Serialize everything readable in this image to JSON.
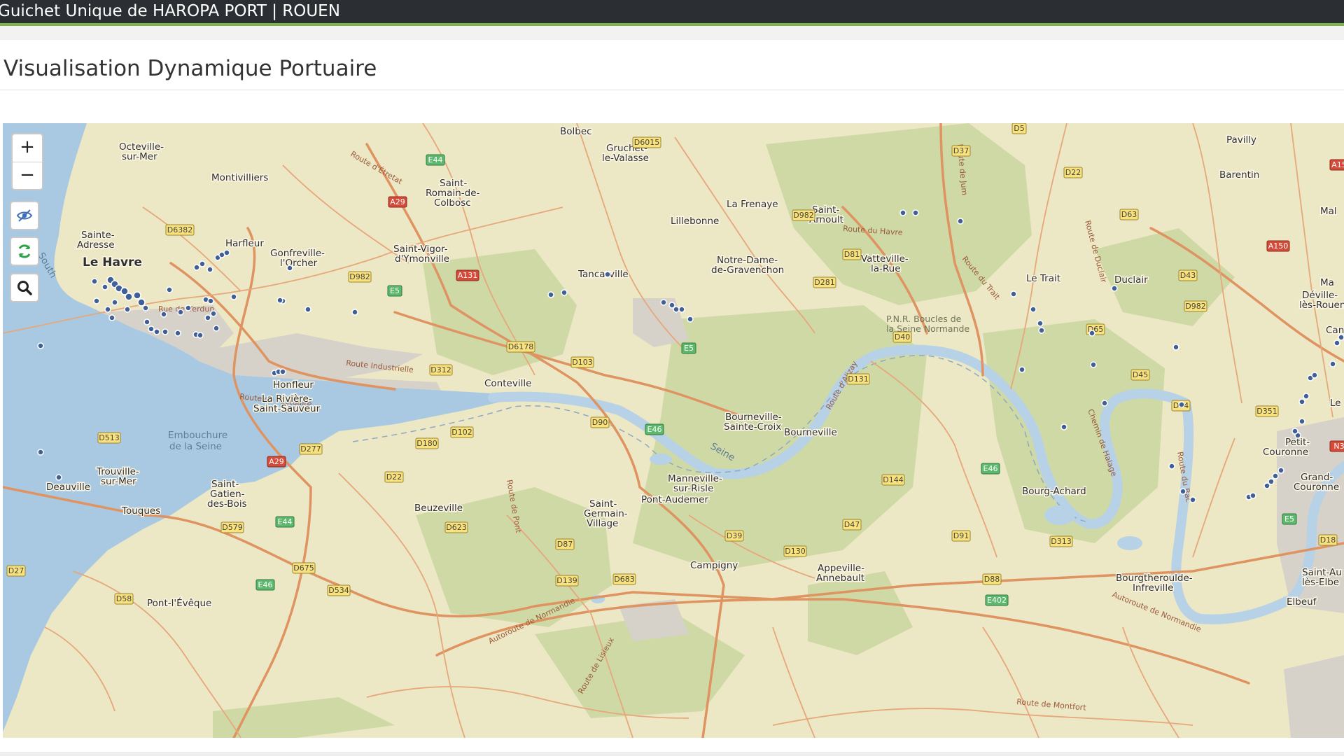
{
  "header": {
    "title": "Guichet Unique de HAROPA PORT | ROUEN"
  },
  "page": {
    "title": "Visualisation Dynamique Portuaire"
  },
  "map": {
    "controls": {
      "zoom_in": "+",
      "zoom_out": "−"
    },
    "colors": {
      "land": "#ece7c4",
      "forest": "#cfd9a6",
      "water": "#b7d1e6",
      "sea": "#a9c9e3",
      "urban": "#d6d2ca",
      "road": "#de9361",
      "vessel": "#3f5f96"
    },
    "places": {
      "le_havre": "Le Havre",
      "octeville": "Octeville-",
      "octeville2": "sur-Mer",
      "montivilliers": "Montivilliers",
      "sainte_adresse": "Sainte-",
      "sainte_adresse2": "Adresse",
      "harfleur": "Harfleur",
      "gonfreville": "Gonfreville-",
      "gonfreville2": "l'Orcher",
      "bolbec": "Bolbec",
      "gruchet": "Gruchet-",
      "gruchet2": "le-Valasse",
      "saint_romain": "Saint-",
      "saint_romain2": "Romain-de-",
      "saint_romain3": "Colbosc",
      "saint_vigor": "Saint-Vigor-",
      "saint_vigor2": "d'Ymonville",
      "tancarville": "Tancarville",
      "lillebonne": "Lillebonne",
      "la_frenaye": "La Frenaye",
      "saint_arnoult": "Saint-",
      "saint_arnoult2": "Arnoult",
      "notre_dame": "Notre-Dame-",
      "notre_dame2": "de-Gravenchon",
      "vatteville": "Vatteville-",
      "vatteville2": "la-Rue",
      "le_trait": "Le Trait",
      "duclair": "Duclair",
      "pavilly": "Pavilly",
      "barentin": "Barentin",
      "deville": "Déville-",
      "deville2": "lès-Rouen",
      "mal": "Mal",
      "ma": "Ma",
      "can": "Can",
      "le": "Le",
      "petit_couronne": "Petit-",
      "petit_couronne2": "Couronne",
      "grand_couronne": "Grand-",
      "grand_couronne2": "Couronne",
      "saint_aubin": "Saint-Au",
      "saint_aubin2": "lès-Elbe",
      "elbeuf": "Elbeuf",
      "honfleur": "Honfleur",
      "la_riviere": "La Rivière-",
      "la_riviere2": "Saint-Sauveur",
      "conteville": "Conteville",
      "trouville": "Trouville-",
      "trouville2": "sur-Mer",
      "deauville": "Deauville",
      "touques": "Touques",
      "saint_gatien": "Saint-",
      "saint_gatien2": "Gatien-",
      "saint_gatien3": "des-Bois",
      "beuzeville": "Beuzeville",
      "saint_germain": "Saint-",
      "saint_germain2": "Germain-",
      "saint_germain3": "Village",
      "pont_audemer": "Pont-Audemer",
      "manneville": "Manneville-",
      "manneville2": "sur-Risle",
      "bourneville_sc": "Bourneville-",
      "bourneville_sc2": "Sainte-Croix",
      "bourneville": "Bourneville",
      "bourg_achard": "Bourg-Achard",
      "campigny": "Campigny",
      "appeville": "Appeville-",
      "appeville2": "Annebault",
      "bourgtheroulde": "Bourgtheroulde-",
      "bourgtheroulde2": "Infreville",
      "pont_leveque": "Pont-l'Évêque"
    },
    "water_labels": {
      "embouchure": "Embouchure",
      "embouchure2": "de la Seine",
      "seine": "Seine",
      "south": "South"
    },
    "park_labels": {
      "pnr": "P.N.R. Boucles de",
      "pnr2": "la Seine Normande"
    },
    "road_labels": {
      "route_etretat": "Route d'Étretat",
      "route_verdun": "Rue de Verdun",
      "route_industrielle": "Route Industrielle",
      "route_estuaire": "Route de l'Estuaire",
      "route_havre": "Route du Havre",
      "route_trait": "Route du Trait",
      "route_alizay": "Route d'Alizay",
      "chemin_halage": "Chemin de Halage",
      "route_bac": "Route du Bac",
      "route_duclair": "Route de Duclair",
      "route_jumieges": "Route de Jum",
      "autoroute_normandie": "Autoroute de Normandie",
      "autoroute_normandie2": "Autoroute de Normandie",
      "route_lisieux": "Route de Lisieux",
      "route_montfort": "Route de Montfort",
      "route_pont": "Route de Pont"
    },
    "shields": {
      "d6015": "D6015",
      "e44_n": "E44",
      "a29_n": "A29",
      "d6382": "D6382",
      "d982_w": "D982",
      "e5_w": "E5",
      "a131": "A131",
      "d5": "D5",
      "d37": "D37",
      "d22": "D22",
      "d63": "D63",
      "d982_n": "D982",
      "d81": "D81",
      "d281": "D281",
      "a150": "A150",
      "d43": "D43",
      "d982_e": "D982",
      "d65": "D65",
      "d40": "D40",
      "d131": "D131",
      "d45": "D45",
      "d64": "D64",
      "d351": "D351",
      "d6178": "D6178",
      "d103": "D103",
      "e5_m": "E5",
      "d312": "D312",
      "d513": "D513",
      "d277": "D277",
      "a29_s": "A29",
      "d180": "D180",
      "d102": "D102",
      "d90": "D90",
      "e46_m": "E46",
      "d22_s": "D22",
      "e44_s": "E44",
      "d579": "D579",
      "d623": "D623",
      "d87": "D87",
      "d39": "D39",
      "d130": "D130",
      "d144": "D144",
      "e46_e": "E46",
      "d47": "D47",
      "d91": "D91",
      "d313": "D313",
      "d18": "D18",
      "d675": "D675",
      "e46_s": "E46",
      "d534": "D534",
      "d27": "D27",
      "d58": "D58",
      "d139": "D139",
      "d683": "D683",
      "d88": "D88",
      "e402": "E402",
      "a15": "A15",
      "n3": "N3",
      "e5_e": "E5"
    }
  }
}
